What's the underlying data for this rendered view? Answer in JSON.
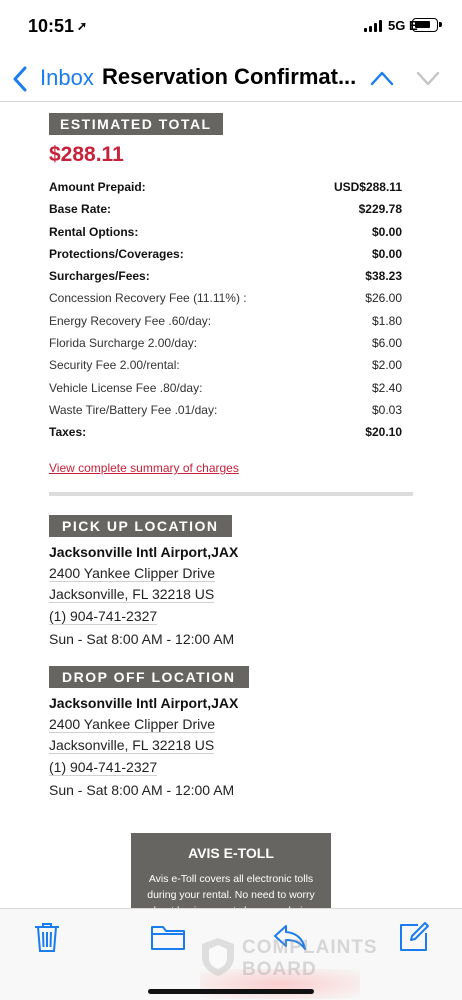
{
  "status_bar": {
    "time": "10:51",
    "network": "5G E"
  },
  "nav": {
    "back_label": "Inbox",
    "title": "Reservation Confirmat..."
  },
  "estimate": {
    "header": "ESTIMATED TOTAL",
    "total": "$288.11",
    "rows": [
      {
        "label": "Amount Prepaid:",
        "value": "USD$288.11",
        "bold": true
      },
      {
        "label": "Base Rate:",
        "value": "$229.78",
        "bold": true
      },
      {
        "label": "Rental Options:",
        "value": "$0.00",
        "bold": true
      },
      {
        "label": "Protections/Coverages:",
        "value": "$0.00",
        "bold": true
      },
      {
        "label": "Surcharges/Fees:",
        "value": "$38.23",
        "bold": true
      },
      {
        "label": "Concession Recovery Fee (11.11%) :",
        "value": "$26.00",
        "bold": false
      },
      {
        "label": "Energy Recovery Fee .60/day:",
        "value": "$1.80",
        "bold": false
      },
      {
        "label": "Florida Surcharge 2.00/day:",
        "value": "$6.00",
        "bold": false
      },
      {
        "label": "Security Fee 2.00/rental:",
        "value": "$2.00",
        "bold": false
      },
      {
        "label": "Vehicle License Fee .80/day:",
        "value": "$2.40",
        "bold": false
      },
      {
        "label": "Waste Tire/Battery Fee .01/day:",
        "value": "$0.03",
        "bold": false
      },
      {
        "label": "Taxes:",
        "value": "$20.10",
        "bold": true
      }
    ],
    "summary_link": "View complete summary of charges"
  },
  "pickup": {
    "header": "PICK UP LOCATION",
    "name": "Jacksonville Intl Airport,JAX",
    "street": "2400 Yankee Clipper Drive",
    "city": "Jacksonville, FL 32218 US",
    "phone": "(1) 904-741-2327",
    "hours": "Sun - Sat 8:00 AM - 12:00 AM"
  },
  "dropoff": {
    "header": "DROP OFF LOCATION",
    "name": "Jacksonville Intl Airport,JAX",
    "street": "2400 Yankee Clipper Drive",
    "city": "Jacksonville, FL 32218 US",
    "phone": "(1) 904-741-2327",
    "hours": "Sun - Sat 8:00 AM - 12:00 AM"
  },
  "etoll": {
    "title": "AVIS E-TOLL",
    "body": "Avis e-Toll covers all electronic tolls during your rental. No need to worry about having exact change or being"
  },
  "toolbar": {
    "icons": [
      "trash-icon",
      "folder-icon",
      "reply-icon",
      "compose-icon"
    ]
  },
  "watermark": {
    "line1": "COMPLAINTS",
    "line2": "BOARD"
  },
  "colors": {
    "accent_blue": "#1b7cf0",
    "total_red": "#c8213a",
    "tag_gray": "#666561"
  }
}
